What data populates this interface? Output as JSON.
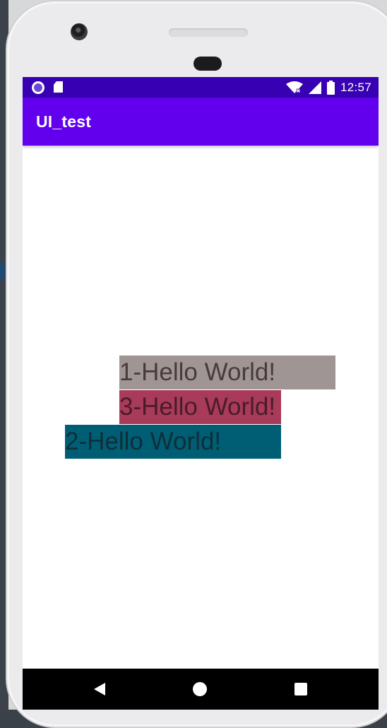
{
  "status_bar": {
    "time": "12:57",
    "left_icons": [
      "circle-notification-icon",
      "sd-card-icon"
    ],
    "right_icons": [
      "wifi-icon",
      "signal-icon",
      "battery-icon"
    ],
    "color": "#3700b3"
  },
  "app_bar": {
    "title": "UI_test",
    "color": "#6200ee"
  },
  "text_views": [
    {
      "text": "1-Hello World!",
      "background": "#9e9594",
      "text_color": "#4a3b3b"
    },
    {
      "text": "3-Hello World!",
      "background": "#a83a5a",
      "text_color": "#4a1c2a"
    },
    {
      "text": "2-Hello World!",
      "background": "#005e74",
      "text_color": "#0d2f39"
    }
  ],
  "nav_bar": {
    "buttons": [
      "back-icon",
      "home-icon",
      "recents-icon"
    ]
  }
}
